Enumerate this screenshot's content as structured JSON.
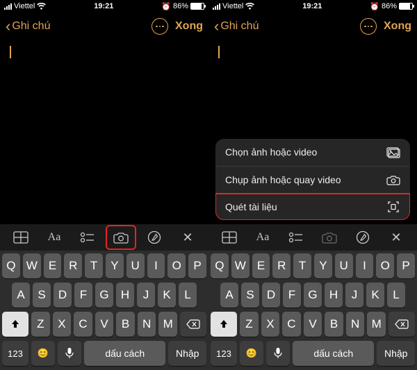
{
  "status": {
    "carrier": "Viettel",
    "time": "19:21",
    "battery_percent": "86%"
  },
  "nav": {
    "back_label": "Ghi chú",
    "done_label": "Xong"
  },
  "menu": {
    "item0": "Chọn ảnh hoặc video",
    "item1": "Chụp ảnh hoặc quay video",
    "item2": "Quét tài liệu"
  },
  "toolbar": {
    "aa_label": "Aa"
  },
  "keyboard": {
    "r1": [
      "Q",
      "W",
      "E",
      "R",
      "T",
      "Y",
      "U",
      "I",
      "O",
      "P"
    ],
    "r2": [
      "A",
      "S",
      "D",
      "F",
      "G",
      "H",
      "J",
      "K",
      "L"
    ],
    "r3": [
      "Z",
      "X",
      "C",
      "V",
      "B",
      "N",
      "M"
    ],
    "num_label": "123",
    "space_label": "dấu cách",
    "return_label": "Nhập"
  }
}
